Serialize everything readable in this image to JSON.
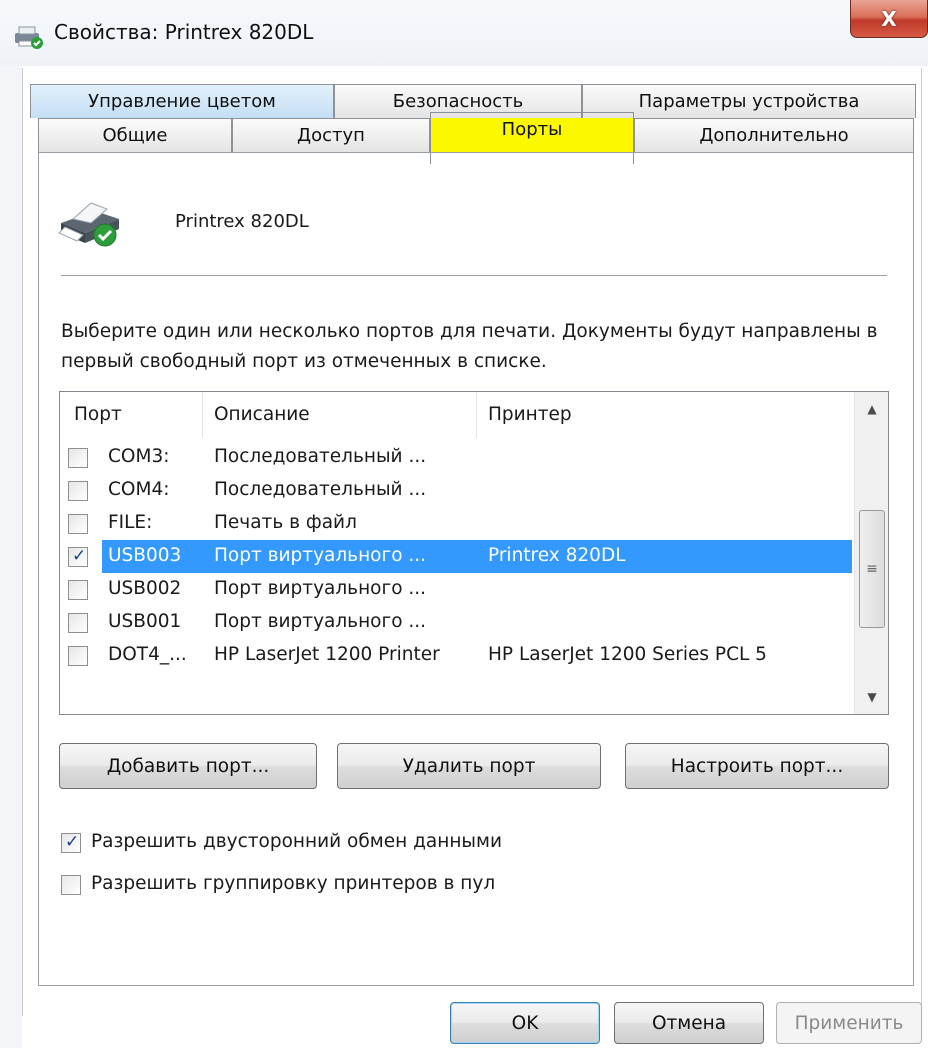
{
  "window": {
    "title": "Свойства: Printrex 820DL",
    "close_glyph": "X"
  },
  "tabs": {
    "row_top": [
      {
        "label": "Управление цветом"
      },
      {
        "label": "Безопасность"
      },
      {
        "label": "Параметры устройства"
      }
    ],
    "row_bottom": [
      {
        "label": "Общие"
      },
      {
        "label": "Доступ"
      },
      {
        "label": "Порты",
        "active": true
      },
      {
        "label": "Дополнительно"
      }
    ]
  },
  "printer": {
    "name": "Printrex 820DL"
  },
  "description": "Выберите один или несколько портов для печати. Документы будут направлены в первый свободный порт из отмеченных в списке.",
  "ports": {
    "columns": [
      "Порт",
      "Описание",
      "Принтер"
    ],
    "rows": [
      {
        "port": "COM3:",
        "desc": "Последовательный ...",
        "printer": "",
        "checked": false
      },
      {
        "port": "COM4:",
        "desc": "Последовательный ...",
        "printer": "",
        "checked": false
      },
      {
        "port": "FILE:",
        "desc": "Печать в файл",
        "printer": "",
        "checked": false
      },
      {
        "port": "USB003",
        "desc": "Порт виртуального ...",
        "printer": "Printrex 820DL",
        "checked": true,
        "selected": true
      },
      {
        "port": "USB002",
        "desc": "Порт виртуального ...",
        "printer": "",
        "checked": false
      },
      {
        "port": "USB001",
        "desc": "Порт виртуального ...",
        "printer": "",
        "checked": false
      },
      {
        "port": "DOT4_...",
        "desc": "HP LaserJet 1200 Printer",
        "printer": "HP LaserJet 1200 Series PCL 5",
        "checked": false
      }
    ]
  },
  "port_buttons": {
    "add": "Добавить порт...",
    "remove": "Удалить порт",
    "configure": "Настроить порт..."
  },
  "options": {
    "bidirectional": {
      "label": "Разрешить двусторонний обмен данными",
      "checked": true
    },
    "pooling": {
      "label": "Разрешить группировку принтеров в пул",
      "checked": false
    }
  },
  "dialog_buttons": {
    "ok": "OK",
    "cancel": "Отмена",
    "apply": "Применить"
  },
  "colors": {
    "selection": "#3399ff",
    "highlight_marker": "#fbf800",
    "tab_blue": "#c4def4"
  }
}
